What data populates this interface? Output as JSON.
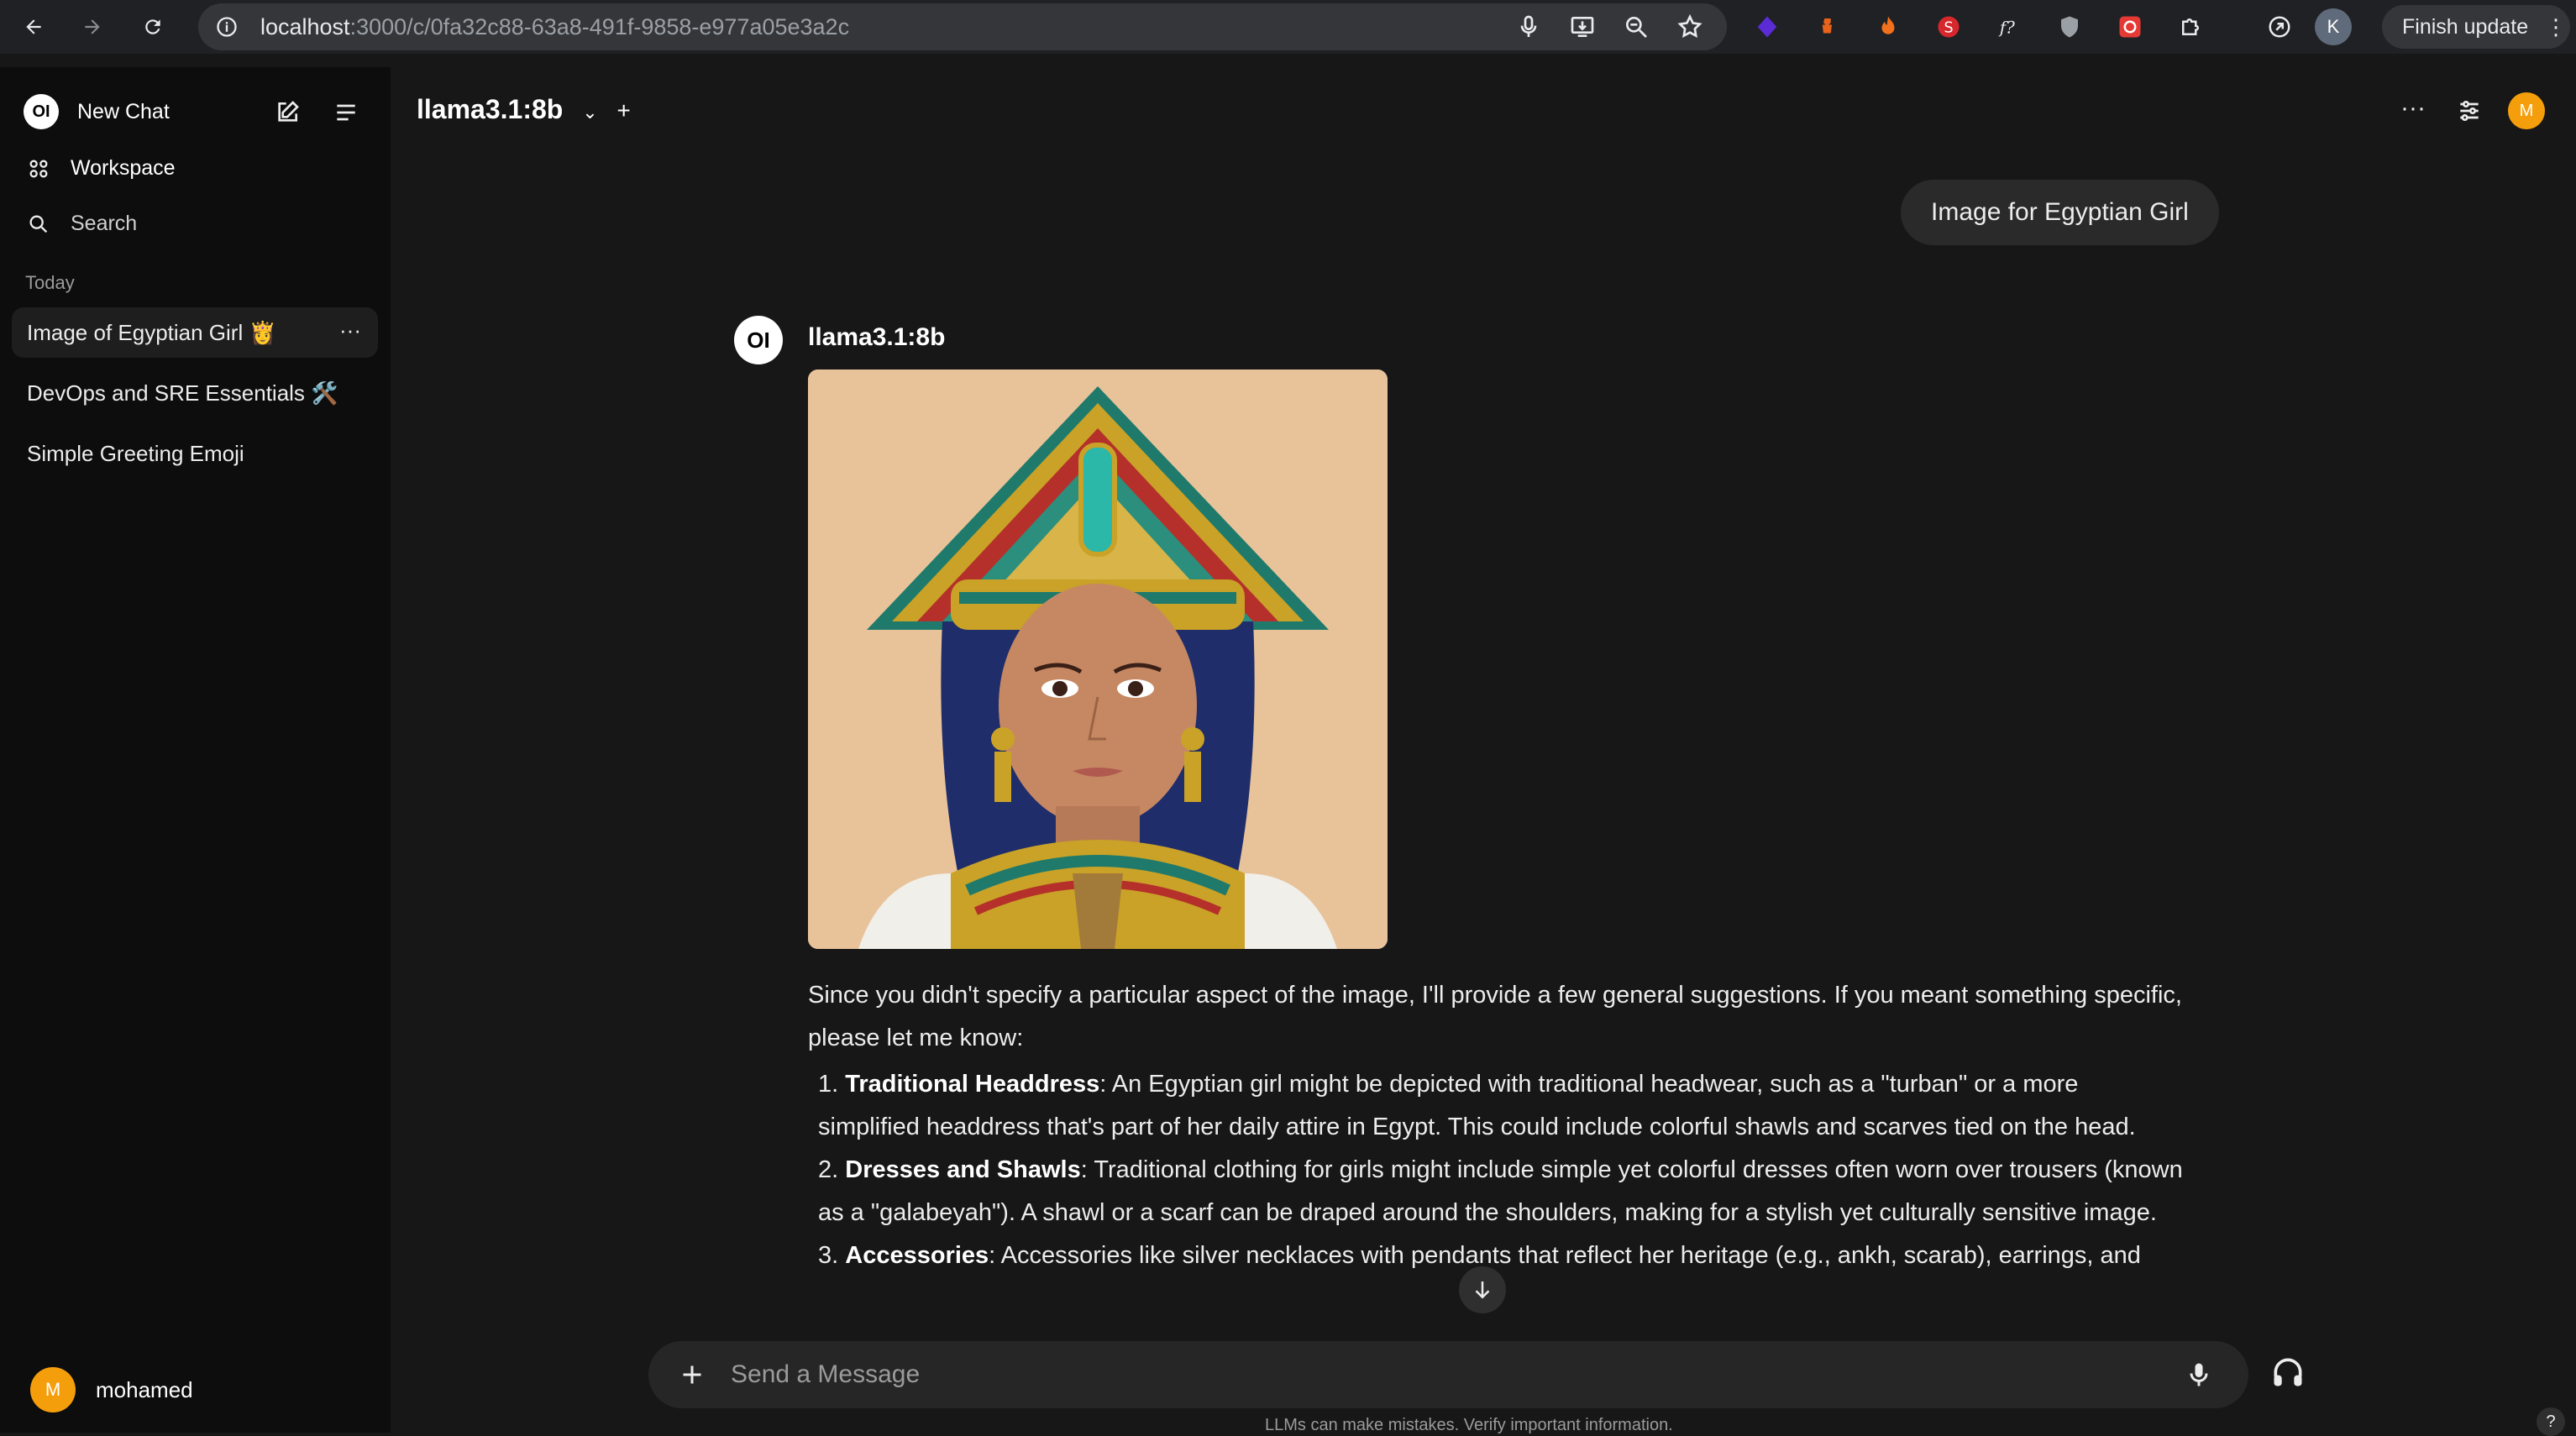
{
  "browser": {
    "url_host": "localhost",
    "url_path": ":3000/c/0fa32c88-63a8-491f-9858-e977a05e3a2c",
    "profile_initial": "K",
    "finish_update_label": "Finish update",
    "icons": [
      "back-icon",
      "forward-icon",
      "reload-icon",
      "site-info-icon",
      "mic-icon",
      "install-icon",
      "zoom-icon",
      "bookmark-star-icon",
      "extension-icons",
      "extensions-puzzle-icon",
      "chrome-menu-icon"
    ]
  },
  "sidebar": {
    "new_chat_label": "New Chat",
    "workspace_label": "Workspace",
    "search_label": "Search",
    "section_today": "Today",
    "chats": [
      {
        "label": "Image of Egyptian Girl 👸"
      },
      {
        "label": "DevOps and SRE Essentials 🛠️"
      },
      {
        "label": "Simple Greeting Emoji"
      }
    ],
    "user": {
      "initial": "M",
      "name": "mohamed"
    }
  },
  "header": {
    "model_name": "llama3.1:8b",
    "add_model_symbol": "+",
    "avatar_initial": "M"
  },
  "conversation": {
    "user_message": "Image for Egyptian Girl",
    "assistant_logo": "OI",
    "assistant_name": "llama3.1:8b",
    "response_intro": "Since you didn't specify a particular aspect of the image, I'll provide a few general suggestions. If you meant something specific, please let me know:",
    "items": [
      {
        "num": "1.",
        "title": "Traditional Headdress",
        "text": ": An Egyptian girl might be depicted with traditional headwear, such as a \"turban\" or a more simplified headdress that's part of her daily attire in Egypt. This could include colorful shawls and scarves tied on the head."
      },
      {
        "num": "2.",
        "title": "Dresses and Shawls",
        "text": ": Traditional clothing for girls might include simple yet colorful dresses often worn over trousers (known as a \"galabeyah\"). A shawl or a scarf can be draped around the shoulders, making for a stylish yet culturally sensitive image."
      },
      {
        "num": "3.",
        "title": "Accessories",
        "text": ": Accessories like silver necklaces with pendants that reflect her heritage (e.g., ankh, scarab), earrings, and"
      }
    ]
  },
  "composer": {
    "placeholder": "Send a Message",
    "disclaimer": "LLMs can make mistakes. Verify important information."
  },
  "help_symbol": "?"
}
